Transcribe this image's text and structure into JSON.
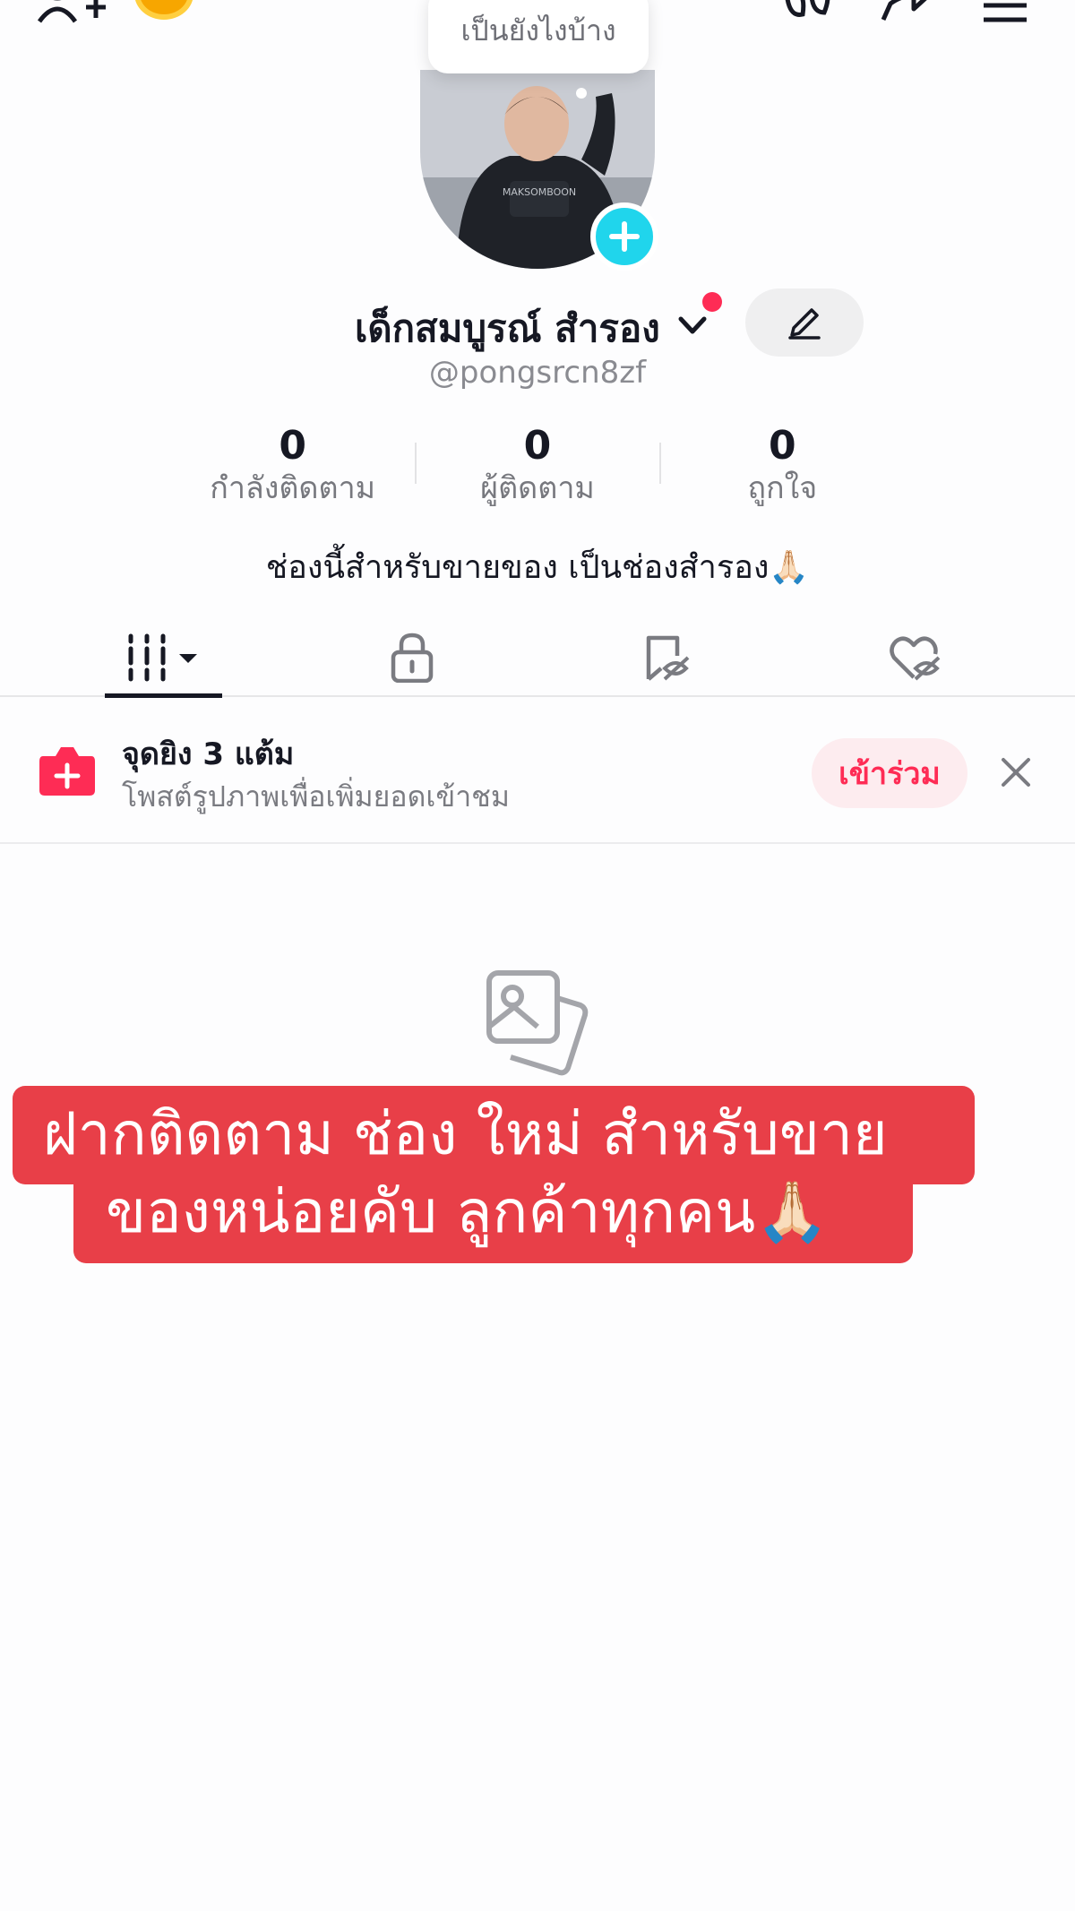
{
  "header": {
    "activity_bubble": "เป็นยังไงบ้าง",
    "icons": [
      "add-friend-icon",
      "coin-icon",
      "footprint-icon",
      "share-icon",
      "menu-icon"
    ]
  },
  "profile": {
    "display_name": "เด็กสมบูรณ์ สำรอง",
    "username": "@pongsrcn8zf",
    "bio": "ช่องนี้สำหรับขายของ เป็นช่องสำรอง🙏🏻",
    "hoodie_text": "MAKSOMBOON"
  },
  "stats": [
    {
      "value": "0",
      "label": "กำลังติดตาม"
    },
    {
      "value": "0",
      "label": "ผู้ติดตาม"
    },
    {
      "value": "0",
      "label": "ถูกใจ"
    }
  ],
  "tabs": [
    {
      "icon": "videos-grid-icon",
      "active": true
    },
    {
      "icon": "private-lock-icon",
      "active": false
    },
    {
      "icon": "favorites-hidden-icon",
      "active": false
    },
    {
      "icon": "liked-hidden-icon",
      "active": false
    }
  ],
  "banner": {
    "title": "จุดยิง 3 แต้ม",
    "subtitle": "โพสต์รูปภาพเพื่อเพิ่มยอดเข้าชม",
    "join_label": "เข้าร่วม"
  },
  "caption": {
    "line1": "ฝากติดตาม ช่อง ใหม่ สำหรับขาย",
    "line2": "ของหน่อยคับ ลูกค้าทุกคน🙏🏻"
  },
  "colors": {
    "accent": "#fe2c55",
    "avatar_plus": "#20d5ec",
    "caption_bg": "#e83f48"
  }
}
